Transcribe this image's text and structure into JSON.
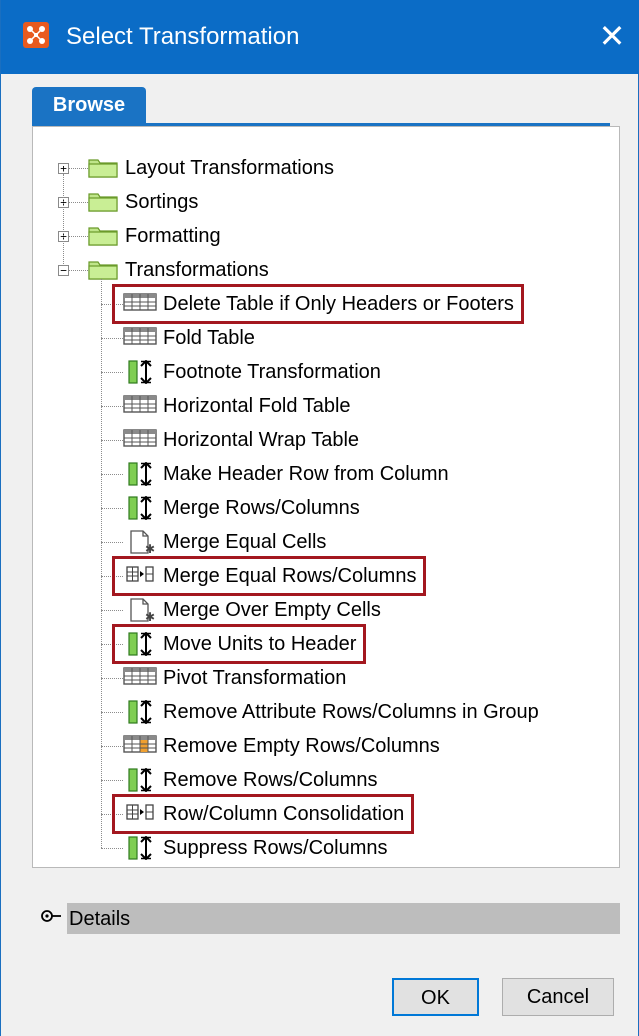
{
  "window": {
    "title": "Select Transformation",
    "close_glyph": "✕"
  },
  "tabs": [
    {
      "label": "Browse",
      "active": true
    }
  ],
  "tree": {
    "groups": [
      {
        "label": "Layout Transformations",
        "expanded": false,
        "icon": "folder-icon"
      },
      {
        "label": "Sortings",
        "expanded": false,
        "icon": "folder-icon"
      },
      {
        "label": "Formatting",
        "expanded": false,
        "icon": "folder-icon"
      },
      {
        "label": "Transformations",
        "expanded": true,
        "icon": "folder-icon"
      }
    ],
    "expander_collapsed": "+",
    "expander_expanded": "−",
    "items": [
      {
        "label": "Delete Table if Only Headers or Footers",
        "icon": "table-icon",
        "highlighted": true
      },
      {
        "label": "Fold Table",
        "icon": "table-icon",
        "highlighted": false
      },
      {
        "label": "Footnote Transformation",
        "icon": "column-arrows-icon",
        "highlighted": false
      },
      {
        "label": "Horizontal Fold Table",
        "icon": "table-icon",
        "highlighted": false
      },
      {
        "label": "Horizontal Wrap Table",
        "icon": "table-icon",
        "highlighted": false
      },
      {
        "label": "Make Header Row from Column",
        "icon": "column-arrows-icon",
        "highlighted": false
      },
      {
        "label": "Merge Rows/Columns",
        "icon": "column-arrows-icon",
        "highlighted": false
      },
      {
        "label": "Merge Equal Cells",
        "icon": "document-icon",
        "highlighted": false
      },
      {
        "label": "Merge Equal Rows/Columns",
        "icon": "consolidate-icon",
        "highlighted": true
      },
      {
        "label": "Merge Over Empty Cells",
        "icon": "document-icon",
        "highlighted": false
      },
      {
        "label": "Move Units to Header",
        "icon": "column-arrows-icon",
        "highlighted": true
      },
      {
        "label": "Pivot Transformation",
        "icon": "table-icon",
        "highlighted": false
      },
      {
        "label": "Remove Attribute Rows/Columns in Group",
        "icon": "column-arrows-icon",
        "highlighted": false
      },
      {
        "label": "Remove Empty Rows/Columns",
        "icon": "table-orange-icon",
        "highlighted": false
      },
      {
        "label": "Remove Rows/Columns",
        "icon": "column-arrows-icon",
        "highlighted": false
      },
      {
        "label": "Row/Column Consolidation",
        "icon": "consolidate-icon",
        "highlighted": true
      },
      {
        "label": "Suppress Rows/Columns",
        "icon": "column-arrows-icon",
        "highlighted": false
      }
    ]
  },
  "details": {
    "label": "Details",
    "expanded": false
  },
  "buttons": {
    "ok": "OK",
    "cancel": "Cancel"
  },
  "colors": {
    "titlebar": "#0b6cc6",
    "tab": "#1a73c4",
    "highlight": "#a3171f"
  }
}
